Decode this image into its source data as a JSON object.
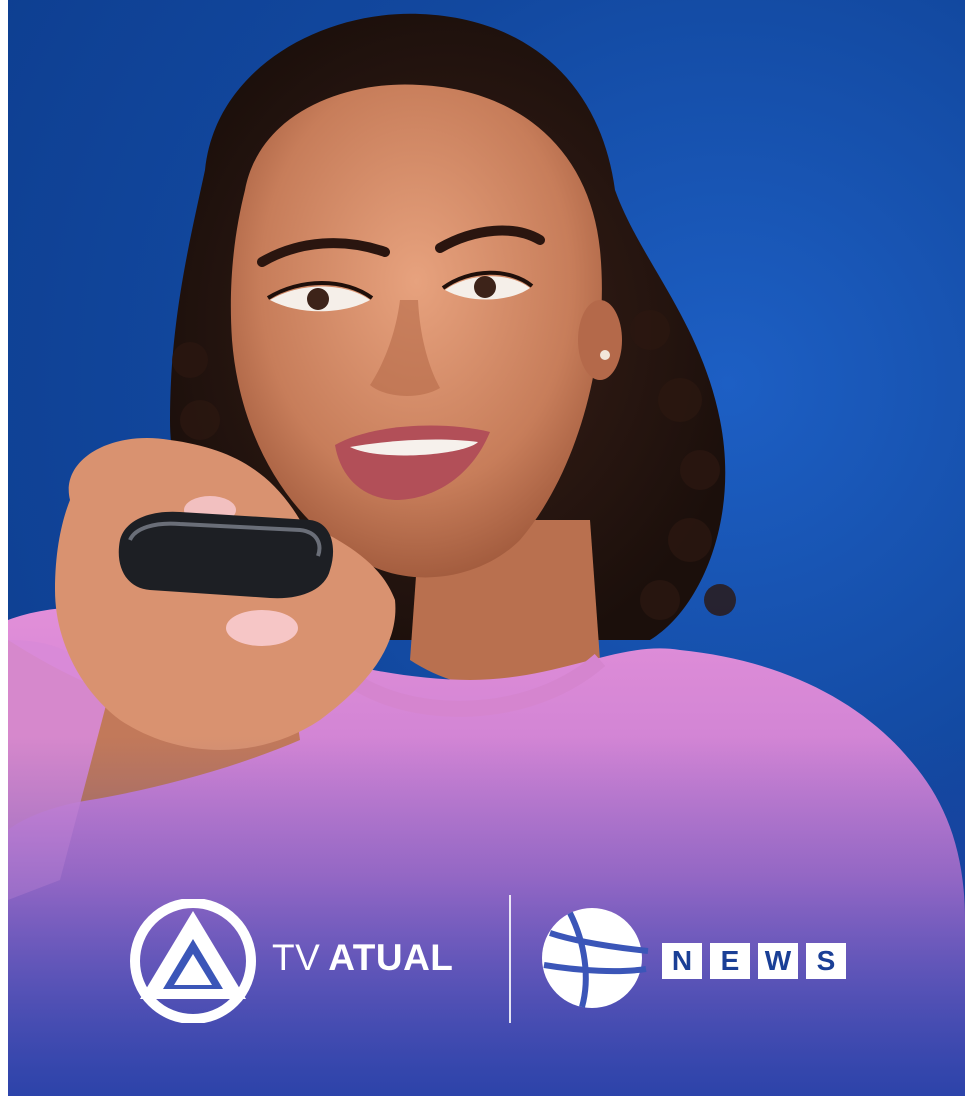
{
  "brand_left": {
    "logo_icon": "tv-atual-emblem-icon",
    "light_word": "TV",
    "bold_word": "ATUAL"
  },
  "brand_right": {
    "logo_icon": "globe-emblem-icon",
    "letters": [
      "N",
      "E",
      "W",
      "S"
    ]
  },
  "colors": {
    "background": "#12489f",
    "shirt": "#c87ad2",
    "logo": "#ffffff"
  }
}
